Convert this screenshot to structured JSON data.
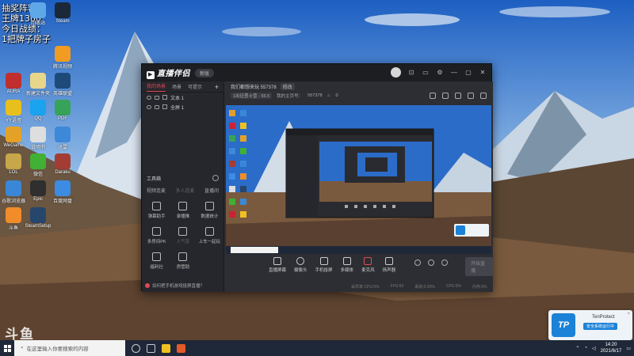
{
  "overlay": {
    "line1": "抽奖阵容：",
    "line2": "王牌1300",
    "line3": "今日战绩：",
    "line4": "1把牌子房子"
  },
  "desktop_icons": [
    {
      "label": "回收站",
      "color": "#5fa8e8"
    },
    {
      "label": "Steam",
      "color": "#1b2838"
    },
    {
      "label": "腾讯视频",
      "color": "#f19b22"
    },
    {
      "label": "AURA",
      "color": "#c12e2e"
    },
    {
      "label": "新建文件夹",
      "color": "#e8d68a"
    },
    {
      "label": "英雄联盟",
      "color": "#1e4a7a"
    },
    {
      "label": "YY语音",
      "color": "#e8c01e"
    },
    {
      "label": "QQ",
      "color": "#1aa3ef"
    },
    {
      "label": "PDF",
      "color": "#37a35a"
    },
    {
      "label": "WeGame",
      "color": "#e4a127"
    },
    {
      "label": "说明书",
      "color": "#dedede"
    },
    {
      "label": "迅雷",
      "color": "#3d88d8"
    },
    {
      "label": "LOL",
      "color": "#c8a74a"
    },
    {
      "label": "微信",
      "color": "#41b035"
    },
    {
      "label": "Daraku",
      "color": "#a33d34"
    },
    {
      "label": "谷歌浏览器",
      "color": "#3a87d8"
    },
    {
      "label": "Epic",
      "color": "#2f2f2f"
    },
    {
      "label": "百度网盘",
      "color": "#3b8ce2"
    },
    {
      "label": "斗鱼",
      "color": "#f08c2a"
    },
    {
      "label": "SteamSetup",
      "color": "#27466b"
    }
  ],
  "app": {
    "logo": "直播伴侣",
    "version": "新版",
    "left_tabs": [
      "我的场景",
      "场景",
      "可提示"
    ],
    "add": "+",
    "sources": [
      {
        "label": "文本 1"
      },
      {
        "label": "全屏 1"
      }
    ],
    "tools_title": "工具箱",
    "tool_tabs": [
      "视频连麦",
      "多人连麦",
      "直播间"
    ],
    "tools": [
      {
        "label": "弹幕助手"
      },
      {
        "label": "录播推"
      },
      {
        "label": "数据统计"
      },
      {
        "label": "多房间PK"
      },
      {
        "label": "人气宝"
      },
      {
        "label": "上车一起玩"
      },
      {
        "label": "福利社"
      },
      {
        "label": "房管助"
      }
    ],
    "tip": "如何把手机游戏投屏直播？",
    "room_title": "我们都想来玩 557378",
    "room_edit": "修改",
    "room_category": "1出征勇士营 - 55.5",
    "room_id_label": "我的主页号：",
    "room_id": "557378",
    "room_count": "0",
    "bottom_tools": [
      {
        "label": "直播屏幕"
      },
      {
        "label": "摄像头"
      },
      {
        "label": "手机投屏"
      },
      {
        "label": "多媒体"
      },
      {
        "label": "麦克风"
      },
      {
        "label": "扬声器"
      }
    ],
    "start_label": "开始直播",
    "status": [
      "采样率 CPU:0%",
      "FPS:60",
      "丢帧:0.00%",
      "CPU:5%",
      "内存:6%"
    ]
  },
  "tenprotect": {
    "name": "TenProtect",
    "status": "安全系统运行中",
    "logo": "TP",
    "close": "×"
  },
  "taskbar": {
    "search_placeholder": "在这里输入你要搜索的内容",
    "time": "14:20",
    "date": "2021/6/17"
  },
  "watermark": "斗鱼"
}
